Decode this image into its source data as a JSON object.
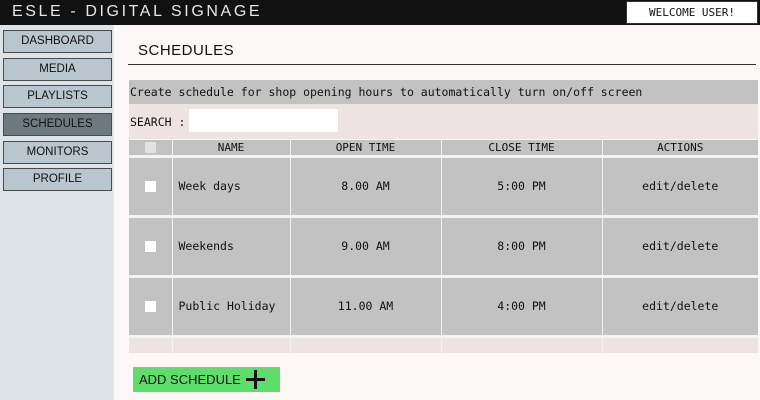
{
  "header": {
    "app_title": "ESLE - DIGITAL SIGNAGE",
    "welcome": "WELCOME USER!"
  },
  "sidebar": {
    "items": [
      {
        "label": "DASHBOARD"
      },
      {
        "label": "MEDIA"
      },
      {
        "label": "PLAYLISTS"
      },
      {
        "label": "SCHEDULES",
        "active": true
      },
      {
        "label": "MONITORS"
      },
      {
        "label": "PROFILE"
      }
    ]
  },
  "main": {
    "title": "SCHEDULES",
    "description": "Create schedule for shop opening hours to automatically turn on/off screen",
    "search": {
      "label": "SEARCH :",
      "value": "",
      "placeholder": ""
    },
    "table": {
      "columns": [
        "NAME",
        "OPEN TIME",
        "CLOSE TIME",
        "ACTIONS"
      ],
      "rows": [
        {
          "name": "Week days",
          "open": "8.00 AM",
          "close": "5:00 PM",
          "actions": "edit/delete"
        },
        {
          "name": "Weekends",
          "open": "9.00 AM",
          "close": "8:00 PM",
          "actions": "edit/delete"
        },
        {
          "name": "Public Holiday",
          "open": "11.00 AM",
          "close": "4:00 PM",
          "actions": "edit/delete"
        }
      ]
    },
    "add_button": {
      "label": "ADD SCHEDULE"
    }
  },
  "colors": {
    "topbar": "#111111",
    "sidebar_bg": "#dde3e7",
    "nav_button": "#b9c6cd",
    "nav_active": "#6f7a80",
    "table_row": "#c2c2c2",
    "add_button": "#5fdd6b"
  },
  "icons": {
    "add": "plus-icon",
    "checkbox": "checkbox"
  }
}
